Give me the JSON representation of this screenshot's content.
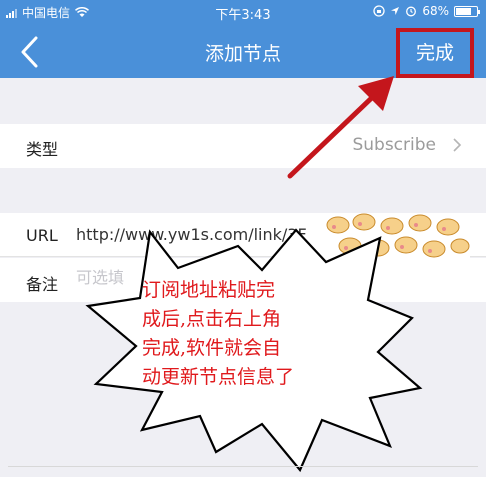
{
  "status_bar": {
    "carrier": "中国电信",
    "time": "下午3:43",
    "battery": "68%"
  },
  "nav": {
    "title": "添加节点",
    "done": "完成"
  },
  "form": {
    "type_label": "类型",
    "type_value": "Subscribe",
    "url_label": "URL",
    "url_value": "http://www.yw1s.com/link/3F",
    "note_label": "备注",
    "note_placeholder": "可选填"
  },
  "annotation": {
    "lines": [
      "订阅地址粘贴完",
      "成后,点击右上角",
      "完成,软件就会自",
      "动更新节点信息了"
    ],
    "color": "#e0191c"
  },
  "colors": {
    "nav_bg": "#4a90d9",
    "highlight": "#c4161c"
  }
}
